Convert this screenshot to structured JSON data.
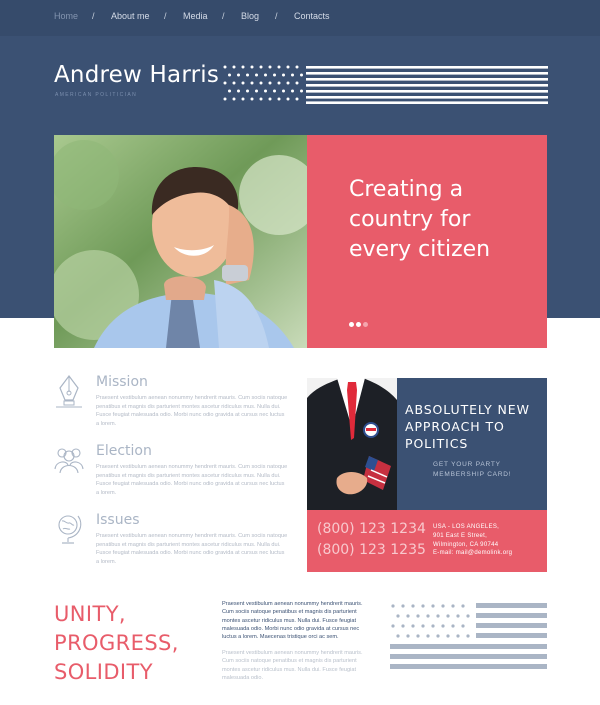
{
  "nav": {
    "items": [
      {
        "label": "Home",
        "active": true
      },
      {
        "label": "About me",
        "active": false
      },
      {
        "label": "Media",
        "active": false
      },
      {
        "label": "Blog",
        "active": false
      },
      {
        "label": "Contacts",
        "active": false
      }
    ],
    "separator": "/"
  },
  "brand": {
    "name": "Andrew Harris",
    "subtitle": "AMERICAN POLITICIAN"
  },
  "hero": {
    "title": "Creating a country for every citizen",
    "slide_count": 3,
    "active_slide": 2
  },
  "features": [
    {
      "icon": "pen-nib-icon",
      "title": "Mission",
      "text": "Praesent vestibulum aenean nonummy hendrerit mauris. Cum sociis natoque penatibus et magnis dis parturient montes ascetur ridiculus mus. Nulla dui. Fusce feugiat malesuada odio. Morbi nunc odio gravida at cursus nec luctus a lorem."
    },
    {
      "icon": "people-icon",
      "title": "Election",
      "text": "Praesent vestibulum aenean nonummy hendrerit mauris. Cum sociis natoque penatibus et magnis dis parturient montes ascetur ridiculus mus. Nulla dui. Fusce feugiat malesuada odio. Morbi nunc odio gravida at cursus nec luctus a lorem."
    },
    {
      "icon": "globe-icon",
      "title": "Issues",
      "text": "Praesent vestibulum aenean nonummy hendrerit mauris. Cum sociis natoque penatibus et magnis dis parturient montes ascetur ridiculus mus. Nulla dui. Fusce feugiat malesuada odio. Morbi nunc odio gravida at cursus nec luctus a lorem."
    }
  ],
  "promo": {
    "title": "ABSOLUTELY NEW APPROACH TO POLITICS",
    "subtitle": "GET YOUR PARTY MEMBERSHIP CARD!",
    "phones": [
      "(800) 123 1234",
      "(800) 123 1235"
    ],
    "address": [
      "USA - LOS ANGELES,",
      "901 East E Street,",
      "Wilmington, CA 90744",
      "E-mail: mail@demolink.org"
    ]
  },
  "bottom": {
    "headline": "UNITY, PROGRESS, SOLIDITY",
    "text_dark": "Praesent vestibulum aenean nonummy hendrerit mauris. Cum sociis natoque penatibus et magnis dis parturient montes ascetur ridiculus mus. Nulla dui. Fusce feugiat malesuada odio. Morbi nunc odio gravida at cursus nec luctus a lorem. Maecenas tristique orci ac sem.",
    "text_light": "Praesent vestibulum aenean nonummy hendrerit mauris. Cum sociis natoque penatibus et magnis dis parturient montes ascetur ridiculus mus. Nulla dui. Fusce feugiat malesuada odio."
  },
  "colors": {
    "navy": "#3b5173",
    "coral": "#e85c6a",
    "muted_text": "#b3bac6"
  }
}
